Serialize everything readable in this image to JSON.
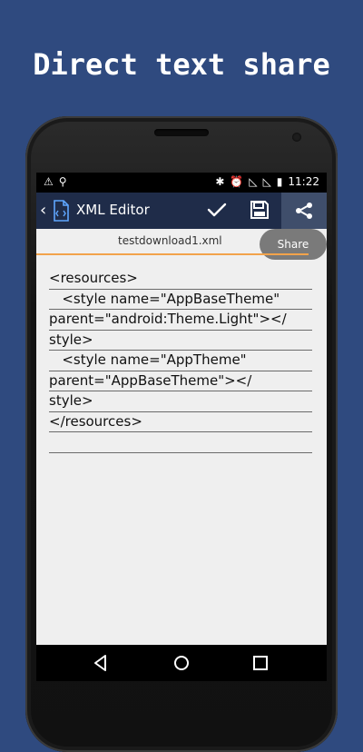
{
  "headline": "Direct text share",
  "status_bar": {
    "time": "11:22",
    "left_icons": [
      "warning-icon",
      "usb-icon"
    ],
    "right_icons": [
      "bluetooth-icon",
      "alarm-icon",
      "signal-icon",
      "signal-icon-2",
      "battery-icon"
    ]
  },
  "app_bar": {
    "title": "XML Editor",
    "actions": [
      "checkmark-icon",
      "save-icon",
      "share-icon"
    ]
  },
  "file": {
    "name": "testdownload1.xml"
  },
  "share_tooltip": "Share",
  "editor": {
    "lines": [
      "<resources>",
      "   <style name=\"AppBaseTheme\"",
      "parent=\"android:Theme.Light\"></",
      "style>",
      "   <style name=\"AppTheme\"",
      "parent=\"AppBaseTheme\"></",
      "style>",
      "</resources>",
      ""
    ]
  },
  "nav_bar": {
    "buttons": [
      "back-icon",
      "home-icon",
      "recents-icon"
    ]
  },
  "colors": {
    "background": "#2f4a7f",
    "app_bar": "#1f2c49",
    "accent": "#f2a34b",
    "editor_bg": "#efefef"
  }
}
